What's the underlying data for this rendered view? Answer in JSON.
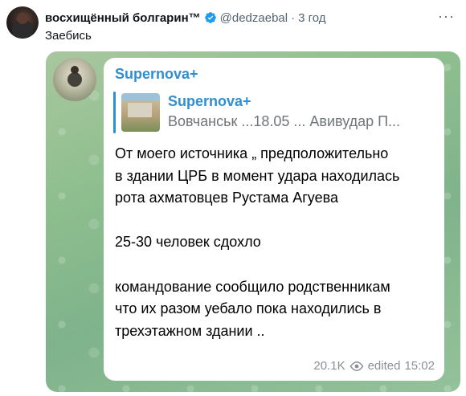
{
  "tweet": {
    "author_name": "восхищённый болгарин™",
    "handle": "@dedzaebal",
    "separator": "·",
    "time": "3 год",
    "text": "Заебись",
    "more": "···"
  },
  "telegram": {
    "channel_name": "Supernova+",
    "reply": {
      "title": "Supernova+",
      "preview": "Вовчанськ ...18.05 ... Авивудар П..."
    },
    "message_lines": [
      "От моего источника „ предположительно",
      "в здании ЦРБ в момент удара находилась",
      "рота ахматовцев Рустама Агуева",
      "",
      "25-30 человек сдохло",
      "",
      "командование сообщило родственникам",
      "что их разом уебало пока находились в",
      "трехэтажном здании .."
    ],
    "views": "20.1K",
    "edited": "edited",
    "time": "15:02"
  },
  "colors": {
    "telegram_accent": "#2f8fd1",
    "verified_blue": "#1d9bf0",
    "muted_text": "#536471"
  },
  "icons": [
    "verified-icon",
    "more-icon",
    "views-eye-icon"
  ]
}
